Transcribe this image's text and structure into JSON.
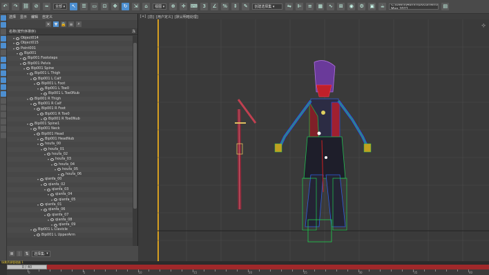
{
  "toolbar": {
    "filter_select": "全部",
    "view_select": "视图",
    "named_select": "创建选择集",
    "path_field": "C:\\Users\\Admin\\Documents\\3ds Max 2021"
  },
  "panel": {
    "menu": [
      "选择",
      "显示",
      "编辑",
      "自定义"
    ],
    "header_label": "名称(按升序排序)",
    "header_right": "冻",
    "items": [
      "Object014",
      "Object015",
      "Point001",
      "Bip001",
      "Bip001 Footsteps",
      "Bip001 Pelvis",
      "Bip001 Spine",
      "Bip001 L Thigh",
      "Bip001 L Calf",
      "Bip001 L Foot",
      "Bip001 L Toe0",
      "Bip001 L Toe0Nub",
      "Bip001 R Thigh",
      "Bip001 R Calf",
      "Bip001 R Foot",
      "Bip001 R Toe0",
      "Bip001 R Toe0Nub",
      "Bip001 Spine1",
      "Bip001 Neck",
      "Bip001 Head",
      "Bip001 HeadNub",
      "houfa_00",
      "houfa_01",
      "houfa_02",
      "houfa_03",
      "houfa_04",
      "houfa_05",
      "houfa_06",
      "qianfa_00",
      "qianfa_02",
      "qianfa_03",
      "qianfa_04",
      "qianfa_05",
      "qianfa_01",
      "qianfa_06",
      "qianfa_07",
      "qianfa_08",
      "qianfa_09",
      "Bip001 L Clavicle",
      "Bip001 L UpperArm"
    ],
    "bottom_label": "默认(未选定)",
    "bottom_select": "选择集:"
  },
  "viewport": {
    "label_parts": [
      "[+]",
      "[前]",
      "[用户定义]",
      "[默认明暗处理]"
    ]
  },
  "timeline": {
    "status": "场景资源管理器 1",
    "slider_text": "0 / 40",
    "tick_labels": [
      "0",
      "5",
      "10",
      "15",
      "20",
      "25",
      "30",
      "35",
      "40"
    ]
  }
}
